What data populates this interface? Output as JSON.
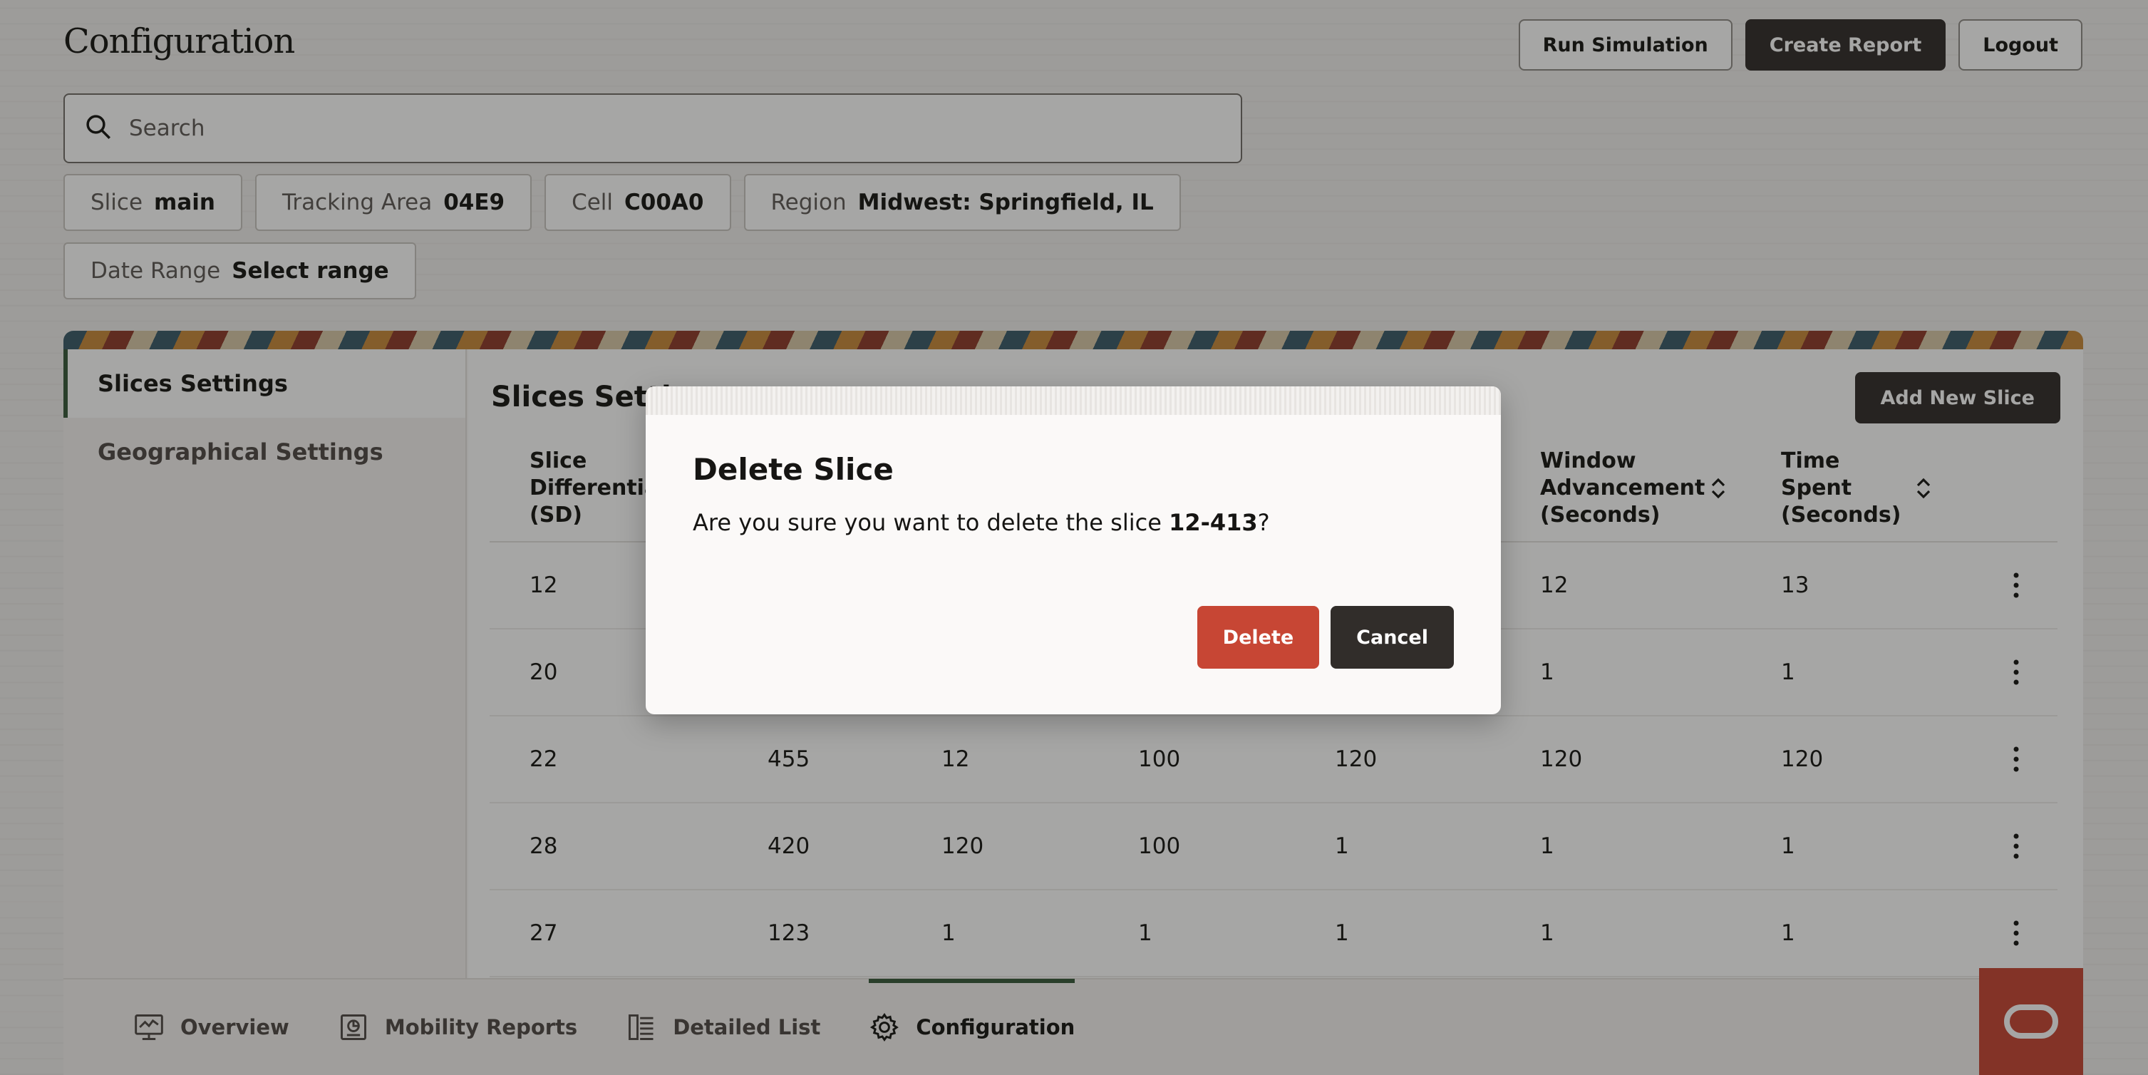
{
  "header": {
    "title": "Configuration",
    "actions": {
      "run_simulation": "Run Simulation",
      "create_report": "Create Report",
      "logout": "Logout"
    }
  },
  "search": {
    "placeholder": "Search",
    "value": ""
  },
  "filters": [
    {
      "label": "Slice",
      "value": "main"
    },
    {
      "label": "Tracking Area",
      "value": "04E9"
    },
    {
      "label": "Cell",
      "value": "C00A0"
    },
    {
      "label": "Region",
      "value": "Midwest: Springfield, IL"
    },
    {
      "label": "Date Range",
      "value": "Select range"
    }
  ],
  "sidebar": {
    "items": [
      {
        "label": "Slices Settings",
        "active": true
      },
      {
        "label": "Geographical Settings",
        "active": false
      }
    ]
  },
  "content": {
    "title_visible": "Slices Setti",
    "add_button": "Add New Slice",
    "columns": [
      "Slice Differentia (SD)",
      "",
      "",
      "",
      "",
      "Window Advancement (Seconds)",
      "Time Spent (Seconds)"
    ],
    "rows": [
      [
        "12",
        "",
        "",
        "",
        "",
        "12",
        "13"
      ],
      [
        "20",
        "",
        "",
        "",
        "",
        "1",
        "1"
      ],
      [
        "22",
        "455",
        "12",
        "100",
        "120",
        "120",
        "120"
      ],
      [
        "28",
        "420",
        "120",
        "100",
        "1",
        "1",
        "1"
      ],
      [
        "27",
        "123",
        "1",
        "1",
        "1",
        "1",
        "1"
      ]
    ]
  },
  "footer_nav": [
    {
      "label": "Overview",
      "icon": "monitor-icon",
      "active": false
    },
    {
      "label": "Mobility Reports",
      "icon": "report-icon",
      "active": false
    },
    {
      "label": "Detailed List",
      "icon": "list-icon",
      "active": false
    },
    {
      "label": "Configuration",
      "icon": "gear-icon",
      "active": true
    }
  ],
  "dialog": {
    "title": "Delete Slice",
    "message_prefix": "Are you sure you want to delete the slice ",
    "slice_id": "12-413",
    "message_suffix": "?",
    "delete_label": "Delete",
    "cancel_label": "Cancel"
  },
  "colors": {
    "accent_dark": "#312d2a",
    "danger": "#c74634",
    "active_green": "#385a3a"
  }
}
